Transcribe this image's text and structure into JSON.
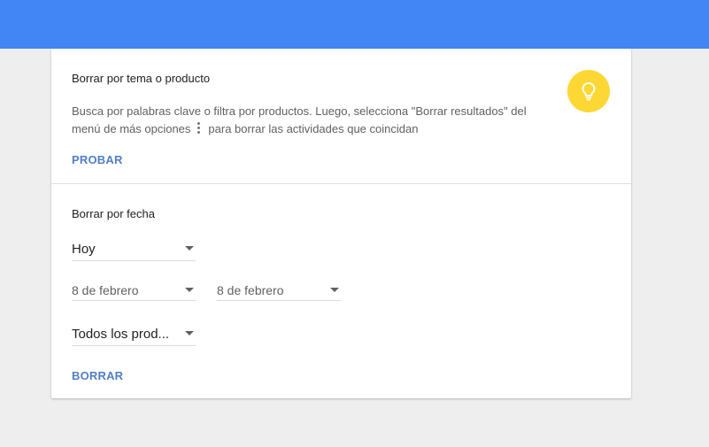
{
  "header": {
    "color": "#4285f4"
  },
  "topic_section": {
    "title": "Borrar por tema o producto",
    "desc_part1": "Busca por palabras clave o filtra por productos. Luego, selecciona \"Borrar resultados\" del menú de más opciones",
    "desc_part2": "para borrar las actividades que coincidan",
    "menu_icon": "more-vert-icon",
    "action_label": "PROBAR",
    "tip_icon": "lightbulb-icon",
    "tip_icon_bg": "#fdd835"
  },
  "date_section": {
    "title": "Borrar por fecha",
    "range_select": {
      "value": "Hoy"
    },
    "start_date": {
      "value": "8 de febrero"
    },
    "end_date": {
      "value": "8 de febrero"
    },
    "product_select": {
      "value": "Todos los prod..."
    },
    "action_label": "BORRAR"
  },
  "colors": {
    "accent_link": "#4f7fc6",
    "page_bg": "#eeeeee"
  }
}
